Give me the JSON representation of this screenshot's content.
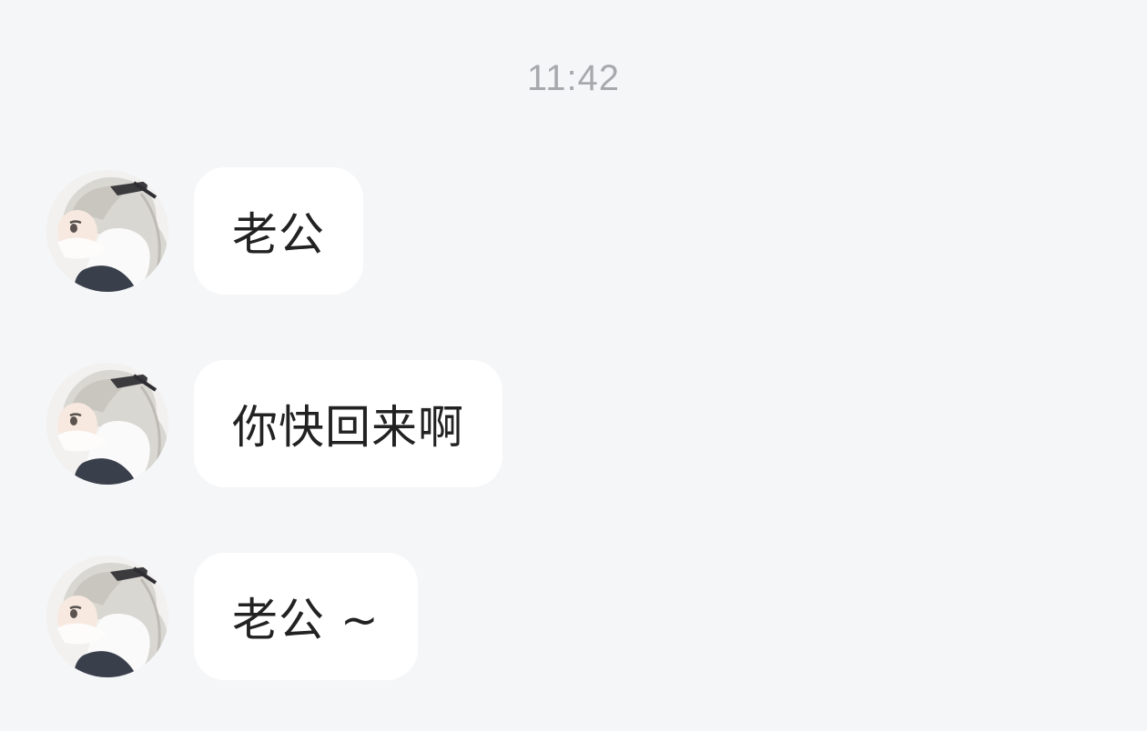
{
  "chat": {
    "timestamp": "11:42",
    "messages": [
      {
        "sender": "contact",
        "avatar_icon": "anime-girl-avatar-icon",
        "text": "老公"
      },
      {
        "sender": "contact",
        "avatar_icon": "anime-girl-avatar-icon",
        "text": "你快回来啊"
      },
      {
        "sender": "contact",
        "avatar_icon": "anime-girl-avatar-icon",
        "text": "老公 ~"
      }
    ]
  },
  "colors": {
    "background": "#f5f6f8",
    "bubble": "#ffffff",
    "message_text": "#222222",
    "timestamp_text": "#a7a9ad"
  }
}
